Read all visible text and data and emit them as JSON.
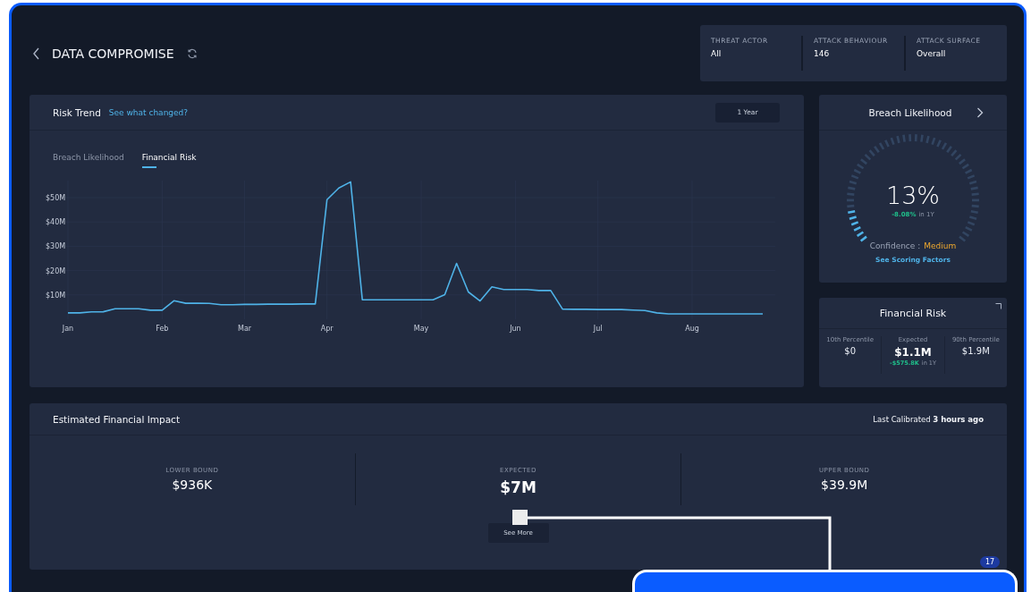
{
  "header": {
    "title": "DATA COMPROMISE"
  },
  "filters": [
    {
      "label": "THREAT ACTOR",
      "value": "All"
    },
    {
      "label": "ATTACK BEHAVIOUR",
      "value": "146"
    },
    {
      "label": "ATTACK SURFACE",
      "value": "Overall"
    }
  ],
  "risk_trend": {
    "title": "Risk Trend",
    "link": "See what changed?",
    "range_button": "1 Year",
    "tabs": [
      {
        "label": "Breach Likelihood",
        "selected": false
      },
      {
        "label": "Financial Risk",
        "selected": true
      }
    ],
    "chart_data": {
      "type": "line",
      "grid": true,
      "ylim": [
        0,
        57
      ],
      "categories": [
        "Jan",
        null,
        null,
        null,
        null,
        null,
        null,
        null,
        "Feb",
        null,
        null,
        null,
        null,
        null,
        null,
        "Mar",
        null,
        null,
        null,
        null,
        null,
        null,
        "Apr",
        null,
        null,
        null,
        null,
        null,
        null,
        null,
        "May",
        null,
        null,
        null,
        null,
        null,
        null,
        null,
        "Jun",
        null,
        null,
        null,
        null,
        null,
        null,
        "Jul",
        null,
        null,
        null,
        null,
        null,
        null,
        null,
        "Aug",
        null,
        null,
        null,
        null,
        null,
        null
      ],
      "series": [
        {
          "color": "#4fb3e8",
          "values": [
            2.6,
            2.6,
            3.0,
            3.1,
            4.3,
            4.3,
            4.3,
            3.7,
            3.7,
            7.6,
            6.6,
            6.6,
            6.5,
            6.0,
            6.0,
            6.1,
            6.1,
            6.2,
            6.2,
            6.2,
            6.3,
            6.3,
            49.2,
            54,
            56.5,
            8,
            8,
            8,
            8,
            8,
            8,
            8,
            10.1,
            23,
            11.2,
            7.5,
            13.3,
            12.2,
            12.2,
            12.2,
            11.8,
            11.8,
            4.2,
            4.1,
            4.1,
            4,
            4,
            4,
            3.8,
            3.6,
            2.6,
            2.2,
            2.2,
            2.2,
            2.2,
            2.2,
            2.2,
            2.2,
            2.2,
            2.2
          ]
        }
      ],
      "yticks": [
        {
          "value": 10,
          "label": "$10M"
        },
        {
          "value": 20,
          "label": "$20M"
        },
        {
          "value": 30,
          "label": "$30M"
        },
        {
          "value": 40,
          "label": "$40M"
        },
        {
          "value": 50,
          "label": "$50M"
        }
      ]
    }
  },
  "breach_likelihood": {
    "title": "Breach Likelihood",
    "value": "13%",
    "level": 0.13,
    "change": "-8.08%",
    "change_period": "in 1Y",
    "confidence_label": "Confidence :",
    "confidence": "Medium",
    "link": "See Scoring Factors"
  },
  "financial_risk": {
    "title": "Financial Risk",
    "columns": [
      {
        "label": "10th Percentile",
        "value": "$0"
      },
      {
        "label": "Expected",
        "value": "$1.1M",
        "change": "-$575.8K",
        "change_period": "in 1Y"
      },
      {
        "label": "90th Percentile",
        "value": "$1.9M"
      }
    ]
  },
  "impact": {
    "title": "Estimated Financial Impact",
    "calibrated": "Last Calibrated **3 hours ago**",
    "columns": [
      {
        "label": "LOWER BOUND",
        "value": "$936K",
        "kind": "bound"
      },
      {
        "label": "EXPECTED",
        "value": "$7M",
        "kind": "main"
      },
      {
        "label": "UPPER BOUND",
        "value": "$39.9M",
        "kind": "bound"
      }
    ],
    "button": "See More"
  },
  "overlay": {
    "badge": "17"
  }
}
